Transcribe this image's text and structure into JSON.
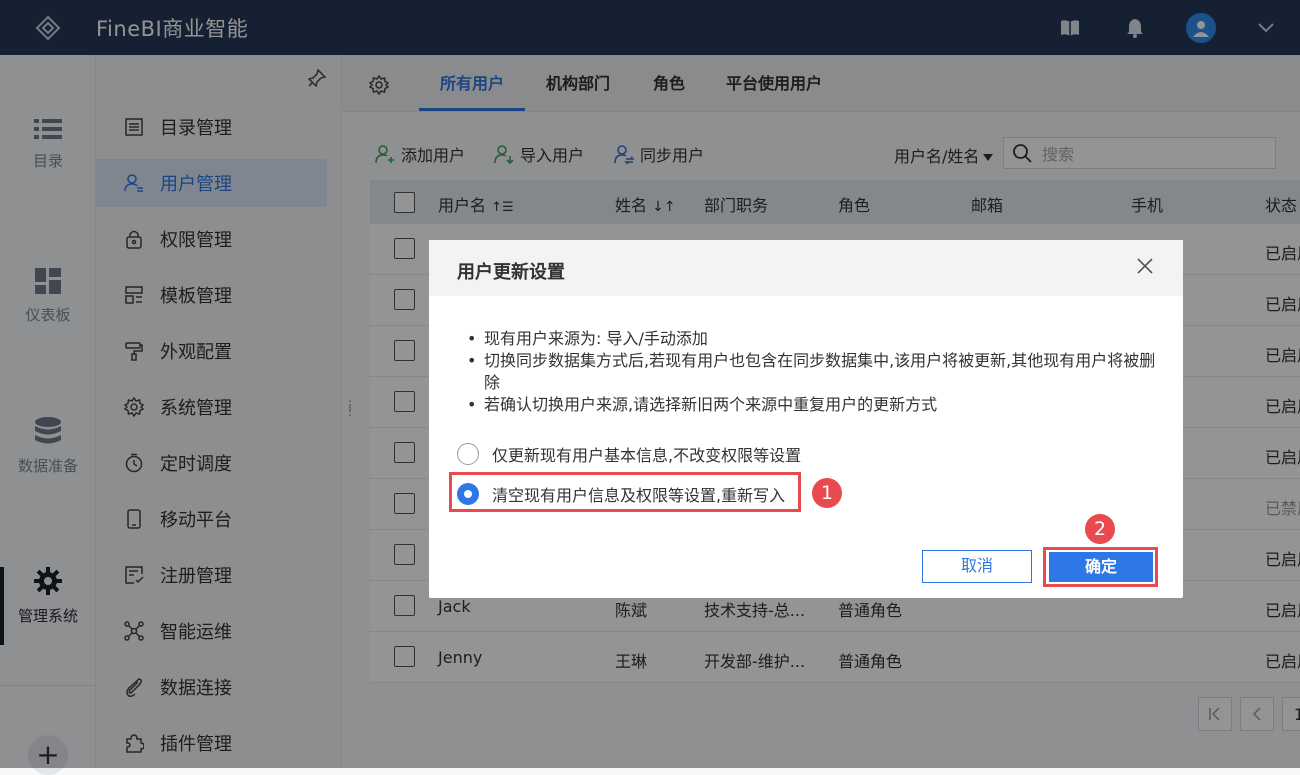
{
  "app": {
    "title": "FineBI商业智能"
  },
  "topbar": {
    "icons": [
      "book-icon",
      "bell-icon",
      "user-avatar-icon",
      "chevron-down-icon"
    ]
  },
  "leftnav": {
    "items": [
      {
        "label": "目录",
        "icon": "list-icon"
      },
      {
        "label": "仪表板",
        "icon": "dashboard-icon"
      },
      {
        "label": "数据准备",
        "icon": "database-icon"
      },
      {
        "label": "管理系统",
        "icon": "gear-icon",
        "active": true
      }
    ],
    "add_label": "+"
  },
  "sidebar": {
    "items": [
      {
        "label": "目录管理",
        "icon": "catalog-icon"
      },
      {
        "label": "用户管理",
        "icon": "user-manage-icon",
        "active": true
      },
      {
        "label": "权限管理",
        "icon": "lock-icon"
      },
      {
        "label": "模板管理",
        "icon": "template-icon"
      },
      {
        "label": "外观配置",
        "icon": "paint-roller-icon"
      },
      {
        "label": "系统管理",
        "icon": "gear-icon"
      },
      {
        "label": "定时调度",
        "icon": "stopwatch-icon"
      },
      {
        "label": "移动平台",
        "icon": "mobile-icon"
      },
      {
        "label": "注册管理",
        "icon": "register-icon"
      },
      {
        "label": "智能运维",
        "icon": "network-icon"
      },
      {
        "label": "数据连接",
        "icon": "paperclip-icon"
      },
      {
        "label": "插件管理",
        "icon": "puzzle-icon"
      }
    ]
  },
  "tabs": [
    {
      "label": "所有用户",
      "active": true
    },
    {
      "label": "机构部门"
    },
    {
      "label": "角色"
    },
    {
      "label": "平台使用用户"
    }
  ],
  "toolbar": {
    "add_user": "添加用户",
    "import_user": "导入用户",
    "sync_user": "同步用户",
    "filter": "用户名/姓名",
    "search_placeholder": "搜索"
  },
  "table": {
    "headers": [
      "用户名",
      "姓名",
      "部门职务",
      "角色",
      "邮箱",
      "手机",
      "状态"
    ],
    "rows": [
      {
        "username": "",
        "name": "",
        "dept": "",
        "role": "",
        "status": "已启用"
      },
      {
        "username": "",
        "name": "",
        "dept": "",
        "role": "",
        "status": "已启用"
      },
      {
        "username": "",
        "name": "",
        "dept": "",
        "role": "",
        "status": "已启用"
      },
      {
        "username": "",
        "name": "",
        "dept": "",
        "role": "",
        "status": "已启用"
      },
      {
        "username": "",
        "name": "",
        "dept": "",
        "role": "",
        "status": "已启用"
      },
      {
        "username": "",
        "name": "",
        "dept": "",
        "role": "",
        "status": "已禁用"
      },
      {
        "username": "",
        "name": "",
        "dept": "",
        "role": "",
        "status": "已启用"
      },
      {
        "username": "Jack",
        "name": "陈斌",
        "dept": "技术支持-总...",
        "role": "普通角色",
        "status": "已启用"
      },
      {
        "username": "Jenny",
        "name": "王琳",
        "dept": "开发部-维护...",
        "role": "普通角色",
        "status": "已启用"
      }
    ]
  },
  "pager": {
    "page": "1"
  },
  "dialog": {
    "title": "用户更新设置",
    "notes": [
      "现有用户来源为: 导入/手动添加",
      "切换同步数据集方式后,若现有用户也包含在同步数据集中,该用户将被更新,其他现有用户将被删除",
      "若确认切换用户来源,请选择新旧两个来源中重复用户的更新方式"
    ],
    "options": [
      {
        "label": "仅更新现有用户基本信息,不改变权限等设置",
        "checked": false
      },
      {
        "label": "清空现有用户信息及权限等设置,重新写入",
        "checked": true
      }
    ],
    "cancel": "取消",
    "confirm": "确定",
    "step_badges": [
      "1",
      "2"
    ]
  },
  "colors": {
    "topbar": "#253756",
    "accent": "#2f77e6",
    "highlight": "#e84a4f"
  }
}
